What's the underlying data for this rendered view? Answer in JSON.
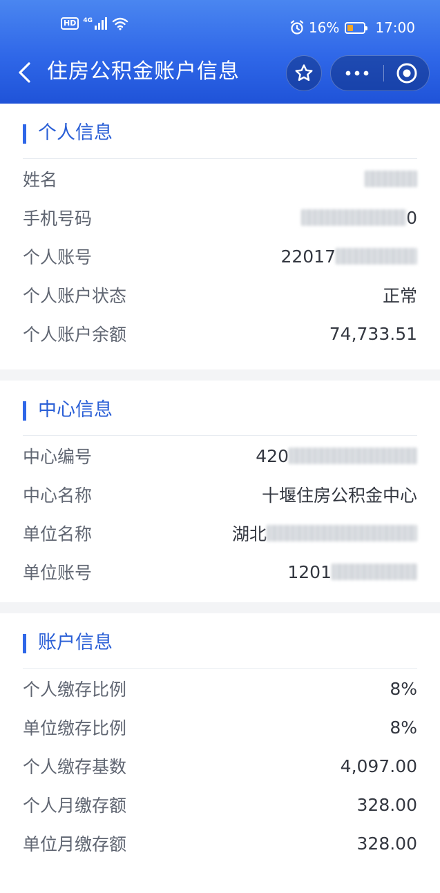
{
  "status_bar": {
    "hd": "HD",
    "network": "4G",
    "battery": "16%",
    "battery_level": 0.16,
    "time": "17:00"
  },
  "nav": {
    "title": "住房公积金账户信息",
    "icons": {
      "back": "chevron-left-icon",
      "favorite": "star-icon",
      "more": "more-dots-icon",
      "close": "target-circle-icon"
    }
  },
  "colors": {
    "header": "#2f67e8",
    "accent": "#2a5fd6",
    "label": "#606672",
    "value": "#333740",
    "divider": "#e8ecf1",
    "gap": "#f3f4f6"
  },
  "personal": {
    "title": "个人信息",
    "rows": [
      {
        "label": "姓名",
        "value": ""
      },
      {
        "label": "手机号码",
        "value": "0"
      },
      {
        "label": "个人账号",
        "value": "22017"
      },
      {
        "label": "个人账户状态",
        "value": "正常"
      },
      {
        "label": "个人账户余额",
        "value": "74,733.51"
      }
    ]
  },
  "center": {
    "title": "中心信息",
    "rows": [
      {
        "label": "中心编号",
        "value": "420"
      },
      {
        "label": "中心名称",
        "value": "十堰住房公积金中心"
      },
      {
        "label": "单位名称",
        "value": "湖北"
      },
      {
        "label": "单位账号",
        "value": "1201"
      }
    ]
  },
  "account": {
    "title": "账户信息",
    "rows": [
      {
        "label": "个人缴存比例",
        "value": "8%"
      },
      {
        "label": "单位缴存比例",
        "value": "8%"
      },
      {
        "label": "个人缴存基数",
        "value": "4,097.00"
      },
      {
        "label": "个人月缴存额",
        "value": "328.00"
      },
      {
        "label": "单位月缴存额",
        "value": "328.00"
      }
    ]
  }
}
